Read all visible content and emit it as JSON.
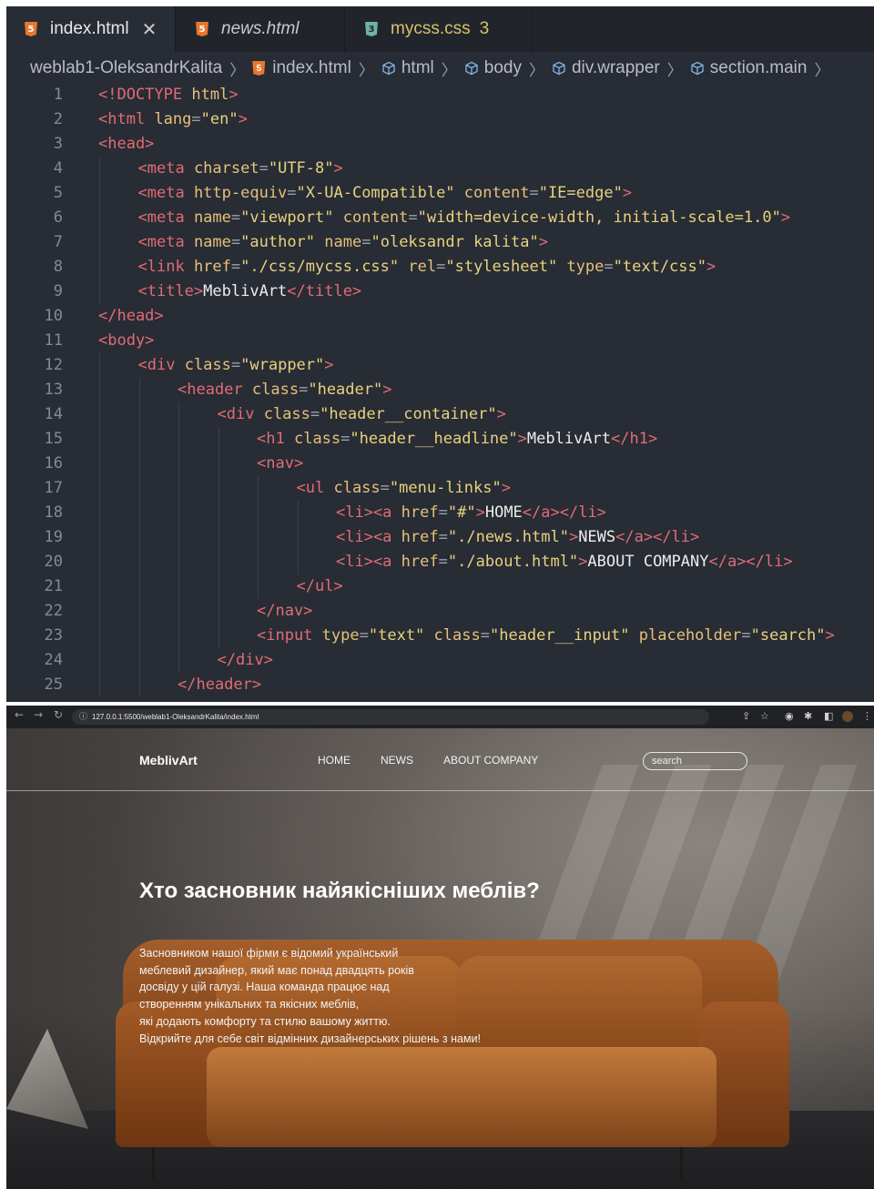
{
  "editor": {
    "tabs": [
      {
        "label": "index.html",
        "icon": "html5-file-icon",
        "close": "✕",
        "active": true
      },
      {
        "label": "news.html",
        "icon": "html5-file-icon",
        "active": false
      },
      {
        "label": "mycss.css",
        "icon": "css3-file-icon",
        "badge": "3",
        "active": false
      }
    ],
    "breadcrumb": [
      "weblab1-OleksandrKalita",
      "index.html",
      "html",
      "body",
      "div.wrapper",
      "section.main"
    ],
    "lines": [
      {
        "n": "1",
        "indent": 0,
        "tokens": [
          [
            "t",
            "<!DOCTYPE"
          ],
          [
            "x",
            " "
          ],
          [
            "a",
            "html"
          ],
          [
            "t",
            ">"
          ]
        ]
      },
      {
        "n": "2",
        "indent": 0,
        "tokens": [
          [
            "t",
            "<html"
          ],
          [
            "x",
            " "
          ],
          [
            "a",
            "lang"
          ],
          [
            "p",
            "="
          ],
          [
            "s",
            "\"en\""
          ],
          [
            "t",
            ">"
          ]
        ]
      },
      {
        "n": "3",
        "indent": 0,
        "tokens": [
          [
            "t",
            "<head>"
          ]
        ]
      },
      {
        "n": "4",
        "indent": 1,
        "tokens": [
          [
            "t",
            "<meta"
          ],
          [
            "x",
            " "
          ],
          [
            "a",
            "charset"
          ],
          [
            "p",
            "="
          ],
          [
            "s",
            "\"UTF-8\""
          ],
          [
            "t",
            ">"
          ]
        ]
      },
      {
        "n": "5",
        "indent": 1,
        "tokens": [
          [
            "t",
            "<meta"
          ],
          [
            "x",
            " "
          ],
          [
            "a",
            "http-equiv"
          ],
          [
            "p",
            "="
          ],
          [
            "s",
            "\"X-UA-Compatible\""
          ],
          [
            "x",
            " "
          ],
          [
            "a",
            "content"
          ],
          [
            "p",
            "="
          ],
          [
            "s",
            "\"IE=edge\""
          ],
          [
            "t",
            ">"
          ]
        ]
      },
      {
        "n": "6",
        "indent": 1,
        "tokens": [
          [
            "t",
            "<meta"
          ],
          [
            "x",
            " "
          ],
          [
            "a",
            "name"
          ],
          [
            "p",
            "="
          ],
          [
            "s",
            "\"viewport\""
          ],
          [
            "x",
            " "
          ],
          [
            "a",
            "content"
          ],
          [
            "p",
            "="
          ],
          [
            "s",
            "\"width=device-width, initial-scale=1.0\""
          ],
          [
            "t",
            ">"
          ]
        ]
      },
      {
        "n": "7",
        "indent": 1,
        "tokens": [
          [
            "t",
            "<meta"
          ],
          [
            "x",
            " "
          ],
          [
            "a",
            "name"
          ],
          [
            "p",
            "="
          ],
          [
            "s",
            "\"author\""
          ],
          [
            "x",
            " "
          ],
          [
            "a",
            "name"
          ],
          [
            "p",
            "="
          ],
          [
            "s",
            "\"oleksandr kalita\""
          ],
          [
            "t",
            ">"
          ]
        ]
      },
      {
        "n": "8",
        "indent": 1,
        "tokens": [
          [
            "t",
            "<link"
          ],
          [
            "x",
            " "
          ],
          [
            "a",
            "href"
          ],
          [
            "p",
            "="
          ],
          [
            "s",
            "\"./css/mycss.css\""
          ],
          [
            "x",
            " "
          ],
          [
            "a",
            "rel"
          ],
          [
            "p",
            "="
          ],
          [
            "s",
            "\"stylesheet\""
          ],
          [
            "x",
            " "
          ],
          [
            "a",
            "type"
          ],
          [
            "p",
            "="
          ],
          [
            "s",
            "\"text/css\""
          ],
          [
            "t",
            ">"
          ]
        ]
      },
      {
        "n": "9",
        "indent": 1,
        "tokens": [
          [
            "t",
            "<title>"
          ],
          [
            "x",
            "MeblivArt"
          ],
          [
            "t",
            "</title>"
          ]
        ]
      },
      {
        "n": "10",
        "indent": 0,
        "tokens": [
          [
            "t",
            "</head>"
          ]
        ]
      },
      {
        "n": "11",
        "indent": 0,
        "tokens": [
          [
            "t",
            "<body>"
          ]
        ]
      },
      {
        "n": "12",
        "indent": 1,
        "tokens": [
          [
            "t",
            "<div"
          ],
          [
            "x",
            " "
          ],
          [
            "a",
            "class"
          ],
          [
            "p",
            "="
          ],
          [
            "s",
            "\"wrapper\""
          ],
          [
            "t",
            ">"
          ]
        ]
      },
      {
        "n": "13",
        "indent": 2,
        "tokens": [
          [
            "t",
            "<header"
          ],
          [
            "x",
            " "
          ],
          [
            "a",
            "class"
          ],
          [
            "p",
            "="
          ],
          [
            "s",
            "\"header\""
          ],
          [
            "t",
            ">"
          ]
        ]
      },
      {
        "n": "14",
        "indent": 3,
        "tokens": [
          [
            "t",
            "<div"
          ],
          [
            "x",
            " "
          ],
          [
            "a",
            "class"
          ],
          [
            "p",
            "="
          ],
          [
            "s",
            "\"header__container\""
          ],
          [
            "t",
            ">"
          ]
        ]
      },
      {
        "n": "15",
        "indent": 4,
        "tokens": [
          [
            "t",
            "<h1"
          ],
          [
            "x",
            " "
          ],
          [
            "a",
            "class"
          ],
          [
            "p",
            "="
          ],
          [
            "s",
            "\"header__headline\""
          ],
          [
            "t",
            ">"
          ],
          [
            "x",
            "MeblivArt"
          ],
          [
            "t",
            "</h1>"
          ]
        ]
      },
      {
        "n": "16",
        "indent": 4,
        "tokens": [
          [
            "t",
            "<nav>"
          ]
        ]
      },
      {
        "n": "17",
        "indent": 5,
        "tokens": [
          [
            "t",
            "<ul"
          ],
          [
            "x",
            " "
          ],
          [
            "a",
            "class"
          ],
          [
            "p",
            "="
          ],
          [
            "s",
            "\"menu-links\""
          ],
          [
            "t",
            ">"
          ]
        ]
      },
      {
        "n": "18",
        "indent": 6,
        "tokens": [
          [
            "t",
            "<li><a"
          ],
          [
            "x",
            " "
          ],
          [
            "a",
            "href"
          ],
          [
            "p",
            "="
          ],
          [
            "s",
            "\"#\""
          ],
          [
            "t",
            ">"
          ],
          [
            "x",
            "HOME"
          ],
          [
            "t",
            "</a></li>"
          ]
        ]
      },
      {
        "n": "19",
        "indent": 6,
        "tokens": [
          [
            "t",
            "<li><a"
          ],
          [
            "x",
            " "
          ],
          [
            "a",
            "href"
          ],
          [
            "p",
            "="
          ],
          [
            "s",
            "\"./news.html\""
          ],
          [
            "t",
            ">"
          ],
          [
            "x",
            "NEWS"
          ],
          [
            "t",
            "</a></li>"
          ]
        ]
      },
      {
        "n": "20",
        "indent": 6,
        "tokens": [
          [
            "t",
            "<li><a"
          ],
          [
            "x",
            " "
          ],
          [
            "a",
            "href"
          ],
          [
            "p",
            "="
          ],
          [
            "s",
            "\"./about.html\""
          ],
          [
            "t",
            ">"
          ],
          [
            "x",
            "ABOUT COMPANY"
          ],
          [
            "t",
            "</a></li>"
          ]
        ]
      },
      {
        "n": "21",
        "indent": 5,
        "tokens": [
          [
            "t",
            "</ul>"
          ]
        ]
      },
      {
        "n": "22",
        "indent": 4,
        "tokens": [
          [
            "t",
            "</nav>"
          ]
        ]
      },
      {
        "n": "23",
        "indent": 4,
        "tokens": [
          [
            "t",
            "<input"
          ],
          [
            "x",
            " "
          ],
          [
            "a",
            "type"
          ],
          [
            "p",
            "="
          ],
          [
            "s",
            "\"text\""
          ],
          [
            "x",
            " "
          ],
          [
            "a",
            "class"
          ],
          [
            "p",
            "="
          ],
          [
            "s",
            "\"header__input\""
          ],
          [
            "x",
            " "
          ],
          [
            "a",
            "placeholder"
          ],
          [
            "p",
            "="
          ],
          [
            "s",
            "\"search\""
          ],
          [
            "t",
            ">"
          ]
        ]
      },
      {
        "n": "24",
        "indent": 3,
        "tokens": [
          [
            "t",
            "</div>"
          ]
        ]
      },
      {
        "n": "25",
        "indent": 2,
        "tokens": [
          [
            "t",
            "</header>"
          ]
        ]
      }
    ]
  },
  "browser": {
    "url": "127.0.0.1:5500/weblab1-OleksandrKalita/index.html",
    "site": {
      "logo": "MeblivArt",
      "menu": [
        "HOME",
        "NEWS",
        "ABOUT COMPANY"
      ],
      "search_placeholder": "search",
      "headline": "Хто засновник найякісніших меблів?",
      "paragraph_lines": [
        "Засновником нашої фірми є відомий український",
        "меблевий дизайнер, який має понад двадцять років",
        "досвіду у цій галузі. Наша команда працює над",
        "створенням унікальних та якісних меблів,",
        "які додають комфорту та стилю вашому життю.",
        "Відкрийте для себе світ відмінних дизайнерських рішень з нами!"
      ]
    }
  },
  "colors": {
    "editor_bg": "#282c34",
    "tag": "#e06c75",
    "attr": "#e5c07b",
    "string": "#e7d27f",
    "leather": "#a55e2a"
  }
}
